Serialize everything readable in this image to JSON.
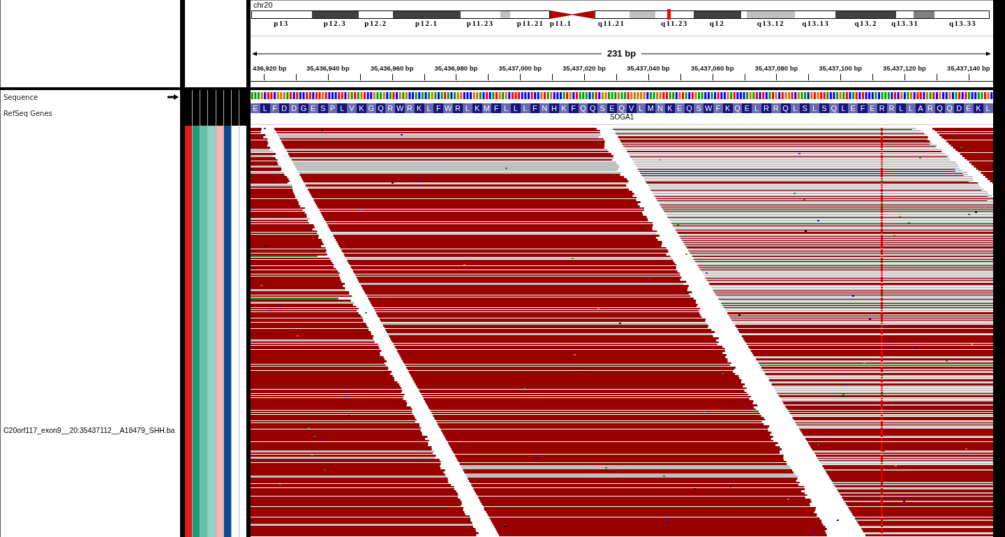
{
  "ruler_panel": {
    "chromosome": "chr20",
    "ideogram_bands": [
      {
        "label": "p13",
        "kind": "gneg",
        "current": false
      },
      {
        "label": "p12.3",
        "kind": "gpos75",
        "current": false
      },
      {
        "label": "p12.2",
        "kind": "gneg",
        "current": false
      },
      {
        "label": "p12.1",
        "kind": "gpos75",
        "current": false
      },
      {
        "label": "p11.23",
        "kind": "gneg",
        "current": false
      },
      {
        "kind": "gpos25",
        "current": false
      },
      {
        "label": "p11.21",
        "kind": "gneg",
        "current": false
      },
      {
        "label": "p11.1",
        "kind": "acen",
        "current": false
      },
      {
        "kind": "acen",
        "current": false
      },
      {
        "label": "q11.21",
        "kind": "gneg",
        "current": false
      },
      {
        "kind": "gpos25",
        "current": false
      },
      {
        "label": "q11.23",
        "kind": "gneg",
        "current": true
      },
      {
        "label": "q12",
        "kind": "gpos75",
        "current": false
      },
      {
        "kind": "gneg",
        "current": false
      },
      {
        "label": "q13.12",
        "kind": "gpos25",
        "current": false
      },
      {
        "label": "q13.13",
        "kind": "gneg",
        "current": false
      },
      {
        "label": "q13.2",
        "kind": "gpos75",
        "current": false
      },
      {
        "label": "q13.31",
        "kind": "gneg",
        "current": false
      },
      {
        "kind": "gpos50",
        "current": false
      },
      {
        "label": "q13.33",
        "kind": "gneg",
        "current": false
      }
    ],
    "span": "231 bp",
    "tick_labels": [
      "436,920 bp",
      "35,436,940 bp",
      "35,436,960 bp",
      "35,436,980 bp",
      "35,437,000 bp",
      "35,437,020 bp",
      "35,437,040 bp",
      "35,437,060 bp",
      "35,437,080 bp",
      "35,437,100 bp",
      "35,437,120 bp",
      "35,437,140 bp"
    ]
  },
  "tracks": [
    {
      "kind": "sequence",
      "name": "Sequence",
      "strand_forward": true
    },
    {
      "kind": "gene",
      "name": "RefSeq Genes",
      "gene_name": "SOGA1",
      "amino_acids": [
        "E",
        "L",
        "F",
        "D",
        "D",
        "G",
        "E",
        "S",
        "P",
        "L",
        "V",
        "K",
        "G",
        "Q",
        "R",
        "W",
        "R",
        "K",
        "L",
        "F",
        "W",
        "R",
        "L",
        "K",
        "M",
        "F",
        "L",
        "L",
        "L",
        "F",
        "N",
        "H",
        "K",
        "F",
        "Q",
        "Q",
        "S",
        "E",
        "Q",
        "V",
        "L",
        "M",
        "N",
        "K",
        "E",
        "Q",
        "S",
        "W",
        "F",
        "K",
        "Q",
        "E",
        "L",
        "R",
        "R",
        "Q",
        "L",
        "S",
        "L",
        "S",
        "Q",
        "L",
        "E",
        "F",
        "E",
        "R",
        "R",
        "L",
        "L",
        "A",
        "R",
        "Q",
        "Q",
        "D",
        "E",
        "K",
        "L"
      ]
    },
    {
      "kind": "alignment",
      "name": "C20orf117_exon9__20:35437112__A18479_SHH.ba",
      "attributes": [
        {
          "color": "#e31a1c"
        },
        {
          "color": "#1b9e77"
        },
        {
          "color": "#66c2a5"
        },
        {
          "color": "#8dd3c7"
        },
        {
          "color": "#fbb4ae"
        },
        {
          "color": "#0c4a94"
        },
        {
          "color": "#ffffff"
        },
        {
          "color": "#ffffff"
        }
      ]
    }
  ]
}
